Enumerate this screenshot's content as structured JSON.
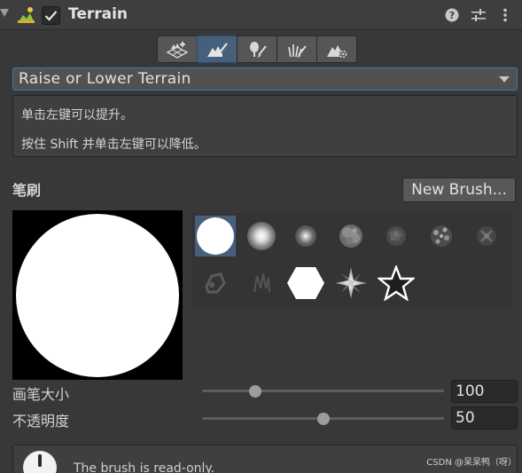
{
  "header": {
    "title": "Terrain",
    "enabled": true,
    "icons": [
      "terrain-component-icon",
      "help-icon",
      "presets-icon",
      "more-menu-icon"
    ]
  },
  "toolbar": {
    "tools": [
      {
        "name": "create-neighbor-terrains",
        "icon": "create-neighbors-icon",
        "active": false
      },
      {
        "name": "paint-terrain",
        "icon": "paint-terrain-icon",
        "active": true
      },
      {
        "name": "paint-trees",
        "icon": "paint-trees-icon",
        "active": false
      },
      {
        "name": "paint-details",
        "icon": "paint-details-icon",
        "active": false
      },
      {
        "name": "terrain-settings",
        "icon": "terrain-settings-icon",
        "active": false
      }
    ]
  },
  "tool_dropdown": {
    "selected": "Raise or Lower Terrain"
  },
  "help": {
    "line1": "单击左键可以提升。",
    "line2": "按住 Shift 并单击左键可以降低。"
  },
  "brushes": {
    "label": "笔刷",
    "new_button": "New Brush...",
    "selected_index": 0,
    "items": [
      "hard-circle-brush",
      "soft-circle-brush",
      "small-soft-circle-brush",
      "noise-brush-1",
      "noise-brush-2",
      "noise-brush-3",
      "noise-brush-4",
      "noise-brush-5",
      "noise-brush-6",
      "hexagon-brush",
      "sparkle-brush",
      "star-brush"
    ]
  },
  "brush_size": {
    "label": "画笔大小",
    "value": "100",
    "fraction": 0.22
  },
  "opacity": {
    "label": "不透明度",
    "value": "50",
    "fraction": 0.5
  },
  "readonly_notice": {
    "text": "The brush is read-only."
  },
  "watermark": "CSDN @呆呆鸭（呀）",
  "colors": {
    "background": "#383838",
    "accent": "#46607c",
    "focus_border": "#3a79bb"
  }
}
